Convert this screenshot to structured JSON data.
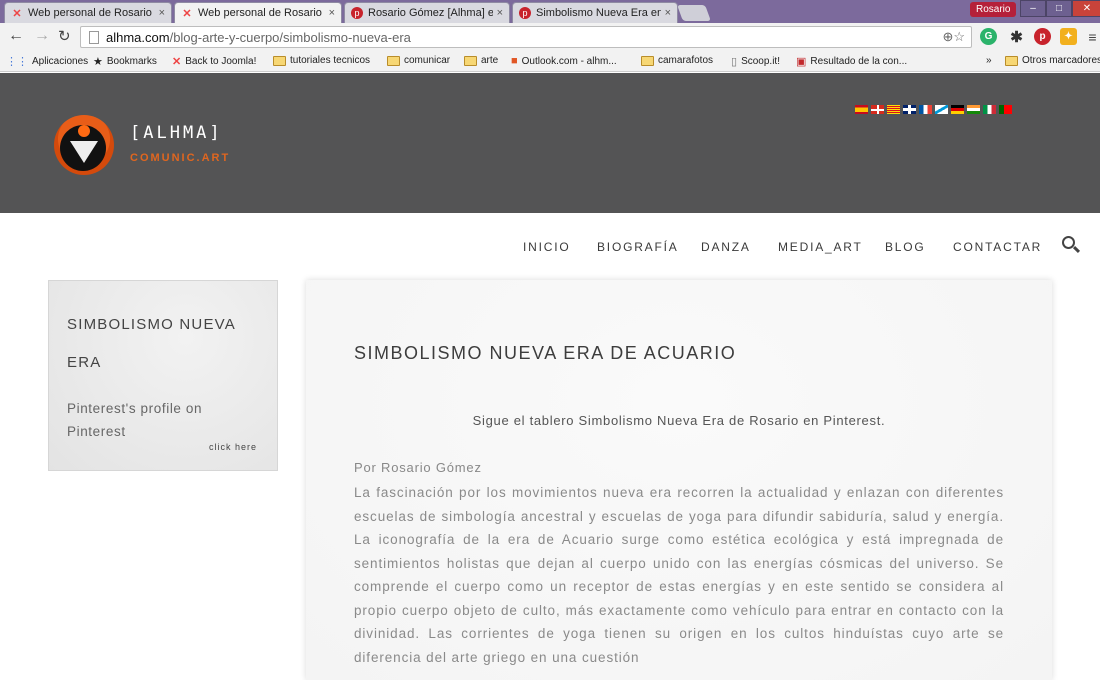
{
  "browser": {
    "tabs": [
      {
        "title": "Web personal de Rosario",
        "icon": "joomla-icon",
        "active": false
      },
      {
        "title": "Web personal de Rosario",
        "icon": "joomla-icon",
        "active": true
      },
      {
        "title": "Rosario Gómez [Alhma] e",
        "icon": "pinterest-icon",
        "active": false
      },
      {
        "title": "Simbolismo Nueva Era en",
        "icon": "pinterest-icon",
        "active": false
      }
    ],
    "close_glyph": "×",
    "user": "Rosario",
    "window_min": "–",
    "window_max": "□",
    "window_close": "✕",
    "url_host": "alhma.com",
    "url_path": "/blog-arte-y-cuerpo/simbolismo-nueva-era",
    "omni_icons": "⊕☆",
    "bookmarks": [
      {
        "label": "Aplicaciones",
        "icon": "apps-grid-icon"
      },
      {
        "label": "Bookmarks",
        "icon": "star-icon"
      },
      {
        "label": "Back to Joomla!",
        "icon": "joomla-icon"
      },
      {
        "label": "tutoriales tecnicos",
        "icon": "folder-icon"
      },
      {
        "label": "comunicar",
        "icon": "folder-icon"
      },
      {
        "label": "arte",
        "icon": "folder-icon"
      },
      {
        "label": "Outlook.com - alhm...",
        "icon": "outlook-icon"
      },
      {
        "label": "camarafotos",
        "icon": "folder-icon"
      },
      {
        "label": "Scoop.it!",
        "icon": "page-icon"
      },
      {
        "label": "Resultado de la con...",
        "icon": "result-icon"
      },
      {
        "label": "»",
        "icon": "overflow-icon"
      },
      {
        "label": "Otros marcadores",
        "icon": "folder-icon"
      }
    ]
  },
  "site": {
    "logo_title": "[ALHMA]",
    "logo_subtitle": "COMUNIC.ART",
    "languages": [
      "es",
      "eu",
      "ca",
      "gb",
      "fr",
      "gl",
      "de",
      "in",
      "it",
      "pt"
    ],
    "nav": [
      "INICIO",
      "BIOGRAFÍA",
      "DANZA",
      "MEDIA_ART",
      "BLOG",
      "CONTACTAR"
    ]
  },
  "sidebar": {
    "title": "SIMBOLISMO NUEVA ERA",
    "profile_text": "Pinterest's profile on Pinterest",
    "click_here": "click here"
  },
  "article": {
    "title": "SIMBOLISMO NUEVA ERA DE ACUARIO",
    "follow_text": "Sigue el tablero Simbolismo Nueva Era de Rosario en Pinterest.",
    "byline": "Por Rosario Gómez",
    "body": "La fascinación por los movimientos nueva era recorren la actualidad y enlazan con diferentes escuelas de simbología ancestral y escuelas de yoga para difundir sabiduría, salud y energía. La iconografía de la era de Acuario surge como estética ecológica y está impregnada de sentimientos holistas que dejan al cuerpo unido con las energías cósmicas del universo. Se comprende el cuerpo como un receptor de estas energías y en este sentido se considera al propio cuerpo objeto de culto, más exactamente como vehículo para entrar en contacto con la divinidad. Las corrientes de yoga tienen su origen en los cultos hinduístas cuyo arte se diferencia del arte griego en una cuestión"
  },
  "colors": {
    "header_bg": "#545455",
    "logo_accent": "#e0661f",
    "tab_bar": "#7c6a9c"
  }
}
